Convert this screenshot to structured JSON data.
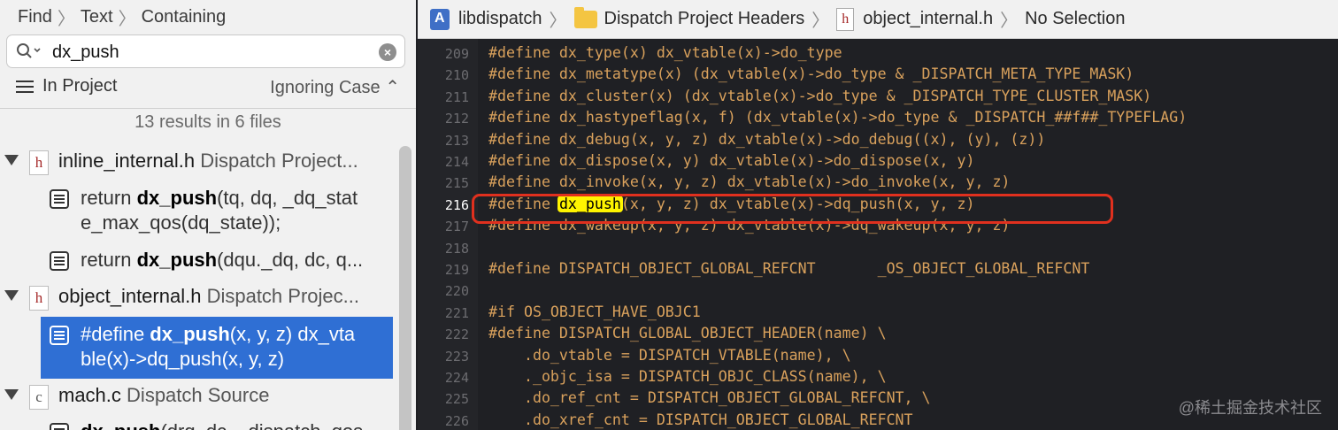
{
  "navigator": {
    "breadcrumb": [
      "Find",
      "Text",
      "Containing"
    ],
    "search": {
      "value": "dx_push"
    },
    "scope": "In Project",
    "case": "Ignoring Case",
    "summary": "13 results in 6 files",
    "files": [
      {
        "name": "inline_internal.h",
        "location": "Dispatch Project...",
        "icon": "h",
        "matches": [
          {
            "before": "return ",
            "match": "dx_push",
            "after": "(tq, dq, _dq_stat",
            "line2": "e_max_qos(dq_state));"
          },
          {
            "before": "return ",
            "match": "dx_push",
            "after": "(dqu._dq, dc, q...",
            "line2": ""
          }
        ]
      },
      {
        "name": "object_internal.h",
        "location": "Dispatch Projec...",
        "icon": "h",
        "matches": [
          {
            "before": "#define ",
            "match": "dx_push",
            "after": "(x, y, z) dx_vta",
            "line2": "ble(x)->dq_push(x, y, z)"
          }
        ]
      },
      {
        "name": "mach.c",
        "location": "Dispatch Source",
        "icon": "c",
        "matches": [
          {
            "before": "",
            "match": "dx_push",
            "after": "(drq, dc, _dispatch_qos",
            "line2": ""
          }
        ]
      }
    ]
  },
  "jumpbar": {
    "project": "libdispatch",
    "group": "Dispatch Project Headers",
    "file": "object_internal.h",
    "selection": "No Selection"
  },
  "editor": {
    "highlight_term": "dx_push",
    "current_line": 216,
    "lines": [
      {
        "n": 209,
        "text": "#define dx_type(x) dx_vtable(x)->do_type"
      },
      {
        "n": 210,
        "text": "#define dx_metatype(x) (dx_vtable(x)->do_type & _DISPATCH_META_TYPE_MASK)"
      },
      {
        "n": 211,
        "text": "#define dx_cluster(x) (dx_vtable(x)->do_type & _DISPATCH_TYPE_CLUSTER_MASK)"
      },
      {
        "n": 212,
        "text": "#define dx_hastypeflag(x, f) (dx_vtable(x)->do_type & _DISPATCH_##f##_TYPEFLAG)"
      },
      {
        "n": 213,
        "text": "#define dx_debug(x, y, z) dx_vtable(x)->do_debug((x), (y), (z))"
      },
      {
        "n": 214,
        "text": "#define dx_dispose(x, y) dx_vtable(x)->do_dispose(x, y)"
      },
      {
        "n": 215,
        "text": "#define dx_invoke(x, y, z) dx_vtable(x)->do_invoke(x, y, z)"
      },
      {
        "n": 216,
        "text": "#define dx_push(x, y, z) dx_vtable(x)->dq_push(x, y, z)"
      },
      {
        "n": 217,
        "text": "#define dx_wakeup(x, y, z) dx_vtable(x)->dq_wakeup(x, y, z)"
      },
      {
        "n": 218,
        "text": ""
      },
      {
        "n": 219,
        "text": "#define DISPATCH_OBJECT_GLOBAL_REFCNT       _OS_OBJECT_GLOBAL_REFCNT"
      },
      {
        "n": 220,
        "text": ""
      },
      {
        "n": 221,
        "text": "#if OS_OBJECT_HAVE_OBJC1"
      },
      {
        "n": 222,
        "text": "#define DISPATCH_GLOBAL_OBJECT_HEADER(name) \\"
      },
      {
        "n": 223,
        "text": "    .do_vtable = DISPATCH_VTABLE(name), \\"
      },
      {
        "n": 224,
        "text": "    ._objc_isa = DISPATCH_OBJC_CLASS(name), \\"
      },
      {
        "n": 225,
        "text": "    .do_ref_cnt = DISPATCH_OBJECT_GLOBAL_REFCNT, \\"
      },
      {
        "n": 226,
        "text": "    .do_xref_cnt = DISPATCH_OBJECT_GLOBAL_REFCNT"
      }
    ]
  },
  "watermark": "@稀土掘金技术社区",
  "colors": {
    "selection": "#2f6fd4",
    "code_text": "#d9a15c",
    "highlight": "#fff400",
    "annotation": "#e0301e"
  }
}
